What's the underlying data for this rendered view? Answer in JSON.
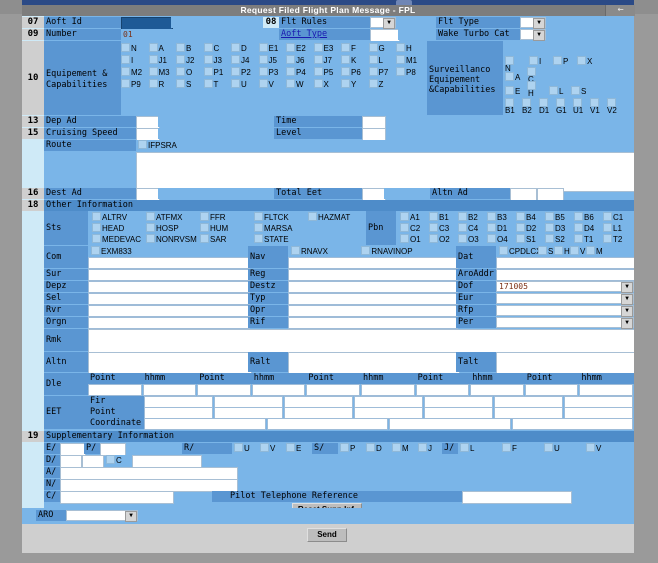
{
  "window": {
    "title": "Request Filed Flight Plan Message - FPL",
    "back_icon": "←"
  },
  "fields": {
    "row07": {
      "num": "07",
      "label": "Aoft Id",
      "value": ""
    },
    "row08": {
      "num": "08",
      "label": "Flt Rules",
      "value": ""
    },
    "flt_type": {
      "label": "Flt Type",
      "value": ""
    },
    "row09": {
      "num": "09",
      "label": "Number",
      "value": "01"
    },
    "aoft_type": {
      "label": "Aoft Type",
      "value": ""
    },
    "wake": {
      "label": "Wake Turbo Cat",
      "value": ""
    },
    "row10": {
      "num": "10",
      "label_line1": "Equipement &",
      "label_line2": "Capabilities"
    },
    "surv": {
      "label_line1": "Surveillanco",
      "label_line2": "Equipement",
      "label_line3": "&Capabilities"
    },
    "row13": {
      "num": "13",
      "label": "Dep Ad",
      "value": ""
    },
    "time": {
      "label": "Time",
      "value": ""
    },
    "row15": {
      "num": "15",
      "label": "Cruising Speed",
      "value": ""
    },
    "level": {
      "label": "Level",
      "value": ""
    },
    "route": {
      "label": "Route",
      "checkbox": "IFPSRA",
      "value": ""
    },
    "row16": {
      "num": "16",
      "label": "Dest Ad",
      "value": ""
    },
    "total_eet": {
      "label": "Total Eet",
      "value": ""
    },
    "altn_ad": {
      "label": "Altn Ad",
      "value1": "",
      "value2": ""
    },
    "row18": {
      "num": "18",
      "label": "Other Information"
    }
  },
  "equipment": {
    "rows": [
      [
        "N",
        "A",
        "B",
        "C",
        "D",
        "E1",
        "E2",
        "E3",
        "F",
        "G",
        "H"
      ],
      [
        "I",
        "J1",
        "J2",
        "J3",
        "J4",
        "J5",
        "J6",
        "J7",
        "K",
        "L",
        "M1"
      ],
      [
        "M2",
        "M3",
        "O",
        "P1",
        "P2",
        "P3",
        "P4",
        "P5",
        "P6",
        "P7",
        "P8"
      ],
      [
        "P9",
        "R",
        "S",
        "T",
        "U",
        "V",
        "W",
        "X",
        "Y",
        "Z"
      ]
    ]
  },
  "surveillance": {
    "row1": [
      "N",
      "I",
      "P",
      "X"
    ],
    "row2": [
      "A",
      "C"
    ],
    "row3": [
      "E",
      "H",
      "L",
      "S"
    ],
    "row4": [
      "B1",
      "B2",
      "D1",
      "G1",
      "U1",
      "V1",
      "V2"
    ]
  },
  "other_info": {
    "sts": {
      "label": "Sts",
      "rows": [
        [
          "ALTRV",
          "ATFMX",
          "FFR",
          "FLTCK",
          "HAZMAT"
        ],
        [
          "HEAD",
          "HOSP",
          "HUM",
          "MARSA"
        ],
        [
          "MEDEVAC",
          "NONRVSM",
          "SAR",
          "STATE"
        ]
      ]
    },
    "pbn": {
      "label": "Pbn",
      "rows": [
        [
          "A1",
          "B1",
          "B2",
          "B3",
          "B4",
          "B5",
          "B6",
          "C1"
        ],
        [
          "C2",
          "C3",
          "C4",
          "D1",
          "D2",
          "D3",
          "D4",
          "L1"
        ],
        [
          "O1",
          "O2",
          "O3",
          "O4",
          "S1",
          "S2",
          "T1",
          "T2"
        ]
      ]
    },
    "com": {
      "label": "Com",
      "checkbox": "EXM833",
      "value": ""
    },
    "nav": {
      "label": "Nav",
      "checkbox1": "RNAVX",
      "checkbox2": "RNAVINOP",
      "value": ""
    },
    "dat": {
      "label": "Dat",
      "checkboxes": [
        "CPDLCX",
        "S",
        "H",
        "V",
        "M"
      ],
      "value": ""
    },
    "sur": {
      "label": "Sur",
      "value": ""
    },
    "reg": {
      "label": "Reg",
      "value": ""
    },
    "aroaddr": {
      "label": "AroAddr",
      "value": ""
    },
    "depz": {
      "label": "Depz",
      "value": ""
    },
    "destz": {
      "label": "Destz",
      "value": ""
    },
    "dof": {
      "label": "Dof",
      "value": "171005"
    },
    "sel": {
      "label": "Sel",
      "value": ""
    },
    "typ": {
      "label": "Typ",
      "value": ""
    },
    "eur": {
      "label": "Eur",
      "value": ""
    },
    "rvr": {
      "label": "Rvr",
      "value": ""
    },
    "opr": {
      "label": "Opr",
      "value": ""
    },
    "rfp": {
      "label": "Rfp",
      "value": ""
    },
    "orgn": {
      "label": "Orgn",
      "value": ""
    },
    "rif": {
      "label": "Rif",
      "value": ""
    },
    "per": {
      "label": "Per",
      "value": ""
    },
    "rmk": {
      "label": "Rmk",
      "value": ""
    },
    "altn": {
      "label": "Altn",
      "value": ""
    },
    "ralt": {
      "label": "Ralt",
      "value": ""
    },
    "talt": {
      "label": "Talt",
      "value": ""
    }
  },
  "dle": {
    "label": "Dle",
    "col_headers": [
      "Point",
      "hhmm",
      "Point",
      "hhmm",
      "Point",
      "hhmm",
      "Point",
      "hhmm",
      "Point",
      "hhmm"
    ],
    "values": [
      "",
      "",
      "",
      "",
      "",
      "",
      "",
      "",
      "",
      ""
    ]
  },
  "eet": {
    "label": "EET",
    "row_labels": [
      "Fir",
      "Point",
      "Coordinate"
    ],
    "fir_values": [
      "",
      "",
      "",
      "",
      "",
      "",
      ""
    ],
    "point_values": [
      "",
      "",
      "",
      "",
      "",
      "",
      ""
    ],
    "coordinate_values": [
      "",
      "",
      "",
      ""
    ]
  },
  "supplementary": {
    "num": "19",
    "header": "Supplementary Information",
    "e_label": "E/",
    "e_value": "",
    "p_label": "P/",
    "p_value": "",
    "r_label": "R/",
    "r_checkboxes": [
      "U",
      "V",
      "E"
    ],
    "s_label": "S/",
    "s_checkboxes": [
      "P",
      "D",
      "M",
      "J"
    ],
    "j_label": "J/",
    "j_checkboxes": [
      "L",
      "F",
      "U",
      "V"
    ],
    "d_label": "D/",
    "d_value1": "",
    "d_value2": "",
    "d_checkbox": "C",
    "d_value3": "",
    "a_label": "A/",
    "a_value": "",
    "n_label": "N/",
    "n_value": "",
    "c_label": "C/",
    "c_value": "",
    "pilot_tel_label": "Pilot Telephone Reference",
    "pilot_tel_value": "",
    "reset_button": "Reset Supp.Inf."
  },
  "footer": {
    "aro_label": "ARO",
    "aro_value": "",
    "send_button": "Send"
  },
  "colors": {
    "form_bg": "#7ab5e8",
    "label_bg": "#5a96d2",
    "header_bg": "#4e8cc9",
    "num_col_bg": "#cfeaf7",
    "title_bg": "#7d7d7d",
    "field_text": "#7a2f14",
    "link": "#1a1ab0"
  }
}
